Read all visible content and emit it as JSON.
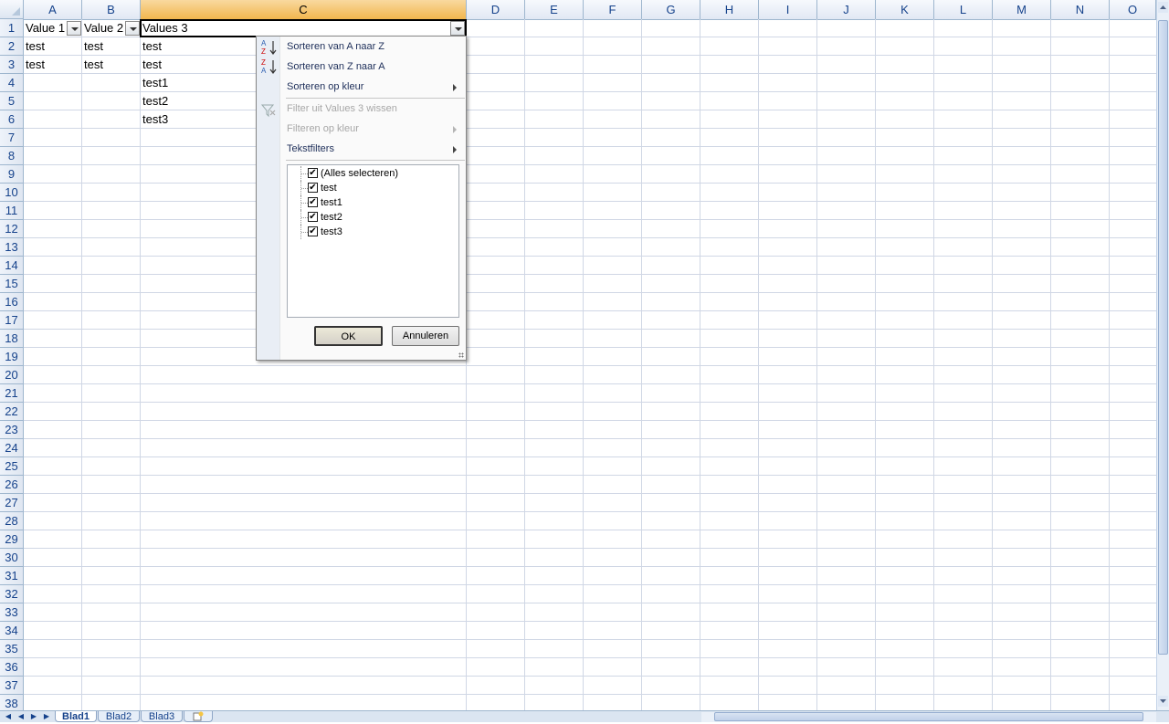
{
  "columns": [
    "A",
    "B",
    "C",
    "D",
    "E",
    "F",
    "G",
    "H",
    "I",
    "J",
    "K",
    "L",
    "M",
    "N",
    "O"
  ],
  "rows": [
    "1",
    "2",
    "3",
    "4",
    "5",
    "6",
    "7",
    "8",
    "9",
    "10",
    "11",
    "12",
    "13",
    "14",
    "15",
    "16",
    "17",
    "18",
    "19",
    "20",
    "21",
    "22",
    "23",
    "24",
    "25",
    "26",
    "27",
    "28",
    "29",
    "30",
    "31",
    "32",
    "33",
    "34",
    "35",
    "36",
    "37",
    "38"
  ],
  "cells": {
    "a1": "Value 1",
    "b1": "Value 2",
    "c1": "Values 3",
    "a2": "test",
    "b2": "test",
    "c2": "test",
    "a3": "test",
    "b3": "test",
    "c3": "test",
    "c4": "test1",
    "c5": "test2",
    "c6": "test3"
  },
  "filter_menu": {
    "sort_az": "Sorteren van A naar Z",
    "sort_za": "Sorteren van Z naar A",
    "sort_color": "Sorteren op kleur",
    "clear_filter": "Filter uit Values 3 wissen",
    "filter_color": "Filteren op kleur",
    "text_filters": "Tekstfilters",
    "values": [
      {
        "label": "(Alles selecteren)",
        "checked": true
      },
      {
        "label": "test",
        "checked": true
      },
      {
        "label": "test1",
        "checked": true
      },
      {
        "label": "test2",
        "checked": true
      },
      {
        "label": "test3",
        "checked": true
      }
    ],
    "ok": "OK",
    "cancel": "Annuleren"
  },
  "sheets": [
    "Blad1",
    "Blad2",
    "Blad3"
  ],
  "active_sheet": "Blad1",
  "colors": {
    "header_active": "#f1b64e",
    "grid": "#d0d7e5",
    "header_text": "#15428b"
  }
}
